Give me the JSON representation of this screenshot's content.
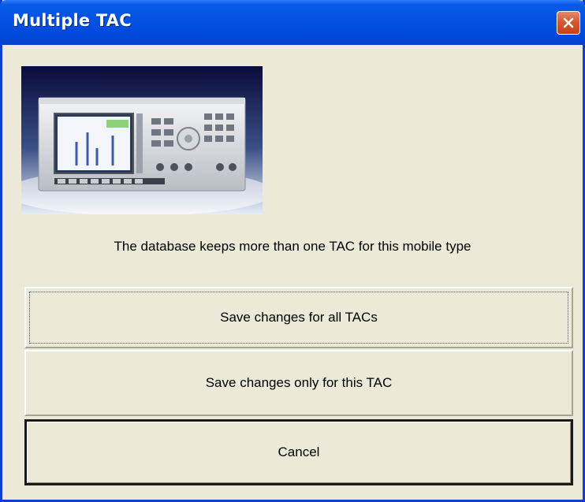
{
  "window": {
    "title": "Multiple TAC",
    "close_icon": "close-icon"
  },
  "colors": {
    "titlebar": "#0352e3",
    "close_button": "#d9582f",
    "dialog_background": "#ece9d8"
  },
  "dialog": {
    "message": "The database keeps more than one TAC for this mobile type",
    "buttons": {
      "save_all": "Save changes for all TACs",
      "save_this": "Save changes only for this TAC",
      "cancel": "Cancel"
    }
  }
}
